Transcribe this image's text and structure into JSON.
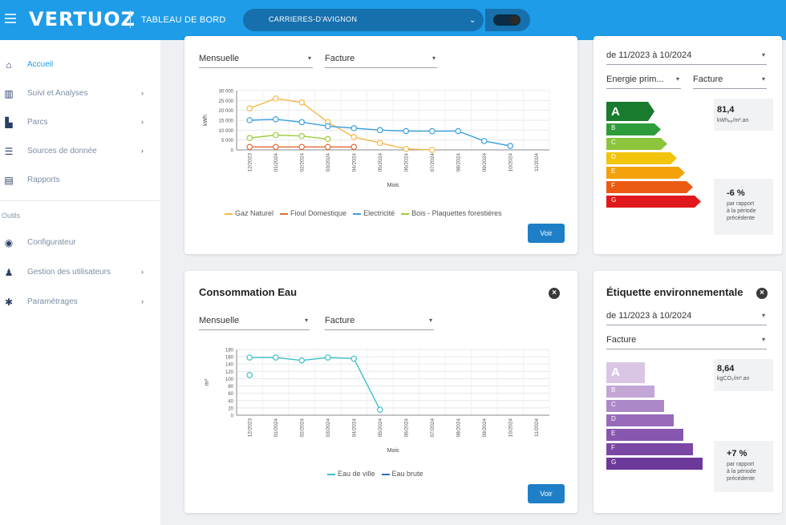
{
  "header": {
    "logo": "VERTUOZ",
    "title": "TABLEAU DE BORD",
    "site": "CARRIERES-D'AVIGNON"
  },
  "sidebar": {
    "items": [
      {
        "label": "Accueil",
        "icon": "home-icon",
        "active": true
      },
      {
        "label": "Suivi et Analyses",
        "icon": "bar-chart-icon",
        "arrow": true
      },
      {
        "label": "Parcs",
        "icon": "buildings-icon",
        "arrow": true
      },
      {
        "label": "Sources de donnée",
        "icon": "database-icon",
        "arrow": true
      },
      {
        "label": "Rapports",
        "icon": "report-icon"
      }
    ],
    "section": "Outils",
    "tools": [
      {
        "label": "Configurateur",
        "icon": "compass-icon"
      },
      {
        "label": "Gestion des utilisateurs",
        "icon": "users-icon",
        "arrow": true
      },
      {
        "label": "Paramétrages",
        "icon": "gear-icon",
        "arrow": true
      }
    ]
  },
  "energy_card": {
    "period_select": "Mensuelle",
    "source_select": "Facture",
    "button": "Voir",
    "legend": [
      {
        "name": "Gaz Naturel",
        "color": "#f6b84a"
      },
      {
        "name": "Fioul Domestique",
        "color": "#e06b3a"
      },
      {
        "name": "Electricité",
        "color": "#3aa0e0"
      },
      {
        "name": "Bois - Plaquettes forestières",
        "color": "#9ccd3c"
      }
    ]
  },
  "water_card": {
    "title": "Consommation Eau",
    "period_select": "Mensuelle",
    "source_select": "Facture",
    "button": "Voir",
    "legend": [
      {
        "name": "Eau de ville",
        "color": "#3cc0c8"
      },
      {
        "name": "Eau brute",
        "color": "#2f6fb0"
      }
    ]
  },
  "dpe_card": {
    "period": "de 11/2023 à 10/2024",
    "type_select": "Energie prim...",
    "source_select": "Facture",
    "grade": "A",
    "value": "81,4",
    "unit": "kWhₑₚ/m².an",
    "delta": "-6 %",
    "delta_text": "par rapport à la période précédente",
    "bars": [
      {
        "letter": "A",
        "color": "#1a7a2e"
      },
      {
        "letter": "B",
        "color": "#2e9c3a"
      },
      {
        "letter": "C",
        "color": "#8cc43c"
      },
      {
        "letter": "D",
        "color": "#f2c40c"
      },
      {
        "letter": "E",
        "color": "#f3a20c"
      },
      {
        "letter": "F",
        "color": "#ec5a12"
      },
      {
        "letter": "G",
        "color": "#e0181c"
      }
    ]
  },
  "env_card": {
    "title": "Étiquette environnementale",
    "period": "de 11/2023 à 10/2024",
    "source_select": "Facture",
    "grade": "A",
    "value": "8,64",
    "unit": "kgCO₂/m².an",
    "delta": "+7 %",
    "delta_text": "par rapport à la période précédente",
    "bars": [
      {
        "letter": "A",
        "color": "#d9c6e4"
      },
      {
        "letter": "B",
        "color": "#c3a5d6"
      },
      {
        "letter": "C",
        "color": "#ad88c8"
      },
      {
        "letter": "D",
        "color": "#976bba"
      },
      {
        "letter": "E",
        "color": "#8756ae"
      },
      {
        "letter": "F",
        "color": "#7a47a4"
      },
      {
        "letter": "G",
        "color": "#6c389a"
      }
    ]
  },
  "chart_data": [
    {
      "type": "line",
      "ylabel": "kWh",
      "xlabel": "Mois",
      "ylim": [
        0,
        30000
      ],
      "yticks": [
        "30 000",
        "25 000",
        "20 000",
        "15 000",
        "10 000",
        "5 000",
        "0"
      ],
      "categories": [
        "12/2023",
        "01/2024",
        "02/2024",
        "03/2024",
        "04/2024",
        "05/2024",
        "06/2024",
        "07/2024",
        "08/2024",
        "09/2024",
        "10/2024",
        "11/2024"
      ],
      "series": [
        {
          "name": "Gaz Naturel",
          "color": "#f6b84a",
          "values": [
            21000,
            26000,
            24000,
            14000,
            6500,
            3500,
            500,
            0,
            null,
            null,
            null,
            null
          ]
        },
        {
          "name": "Fioul Domestique",
          "color": "#e06b3a",
          "values": [
            1500,
            1500,
            1500,
            1500,
            1500,
            null,
            null,
            null,
            null,
            null,
            null,
            null
          ]
        },
        {
          "name": "Electricité",
          "color": "#3aa0e0",
          "values": [
            15000,
            15500,
            14000,
            12000,
            11000,
            10000,
            9500,
            9500,
            9500,
            4500,
            2000,
            null
          ]
        },
        {
          "name": "Bois - Plaquettes forestières",
          "color": "#9ccd3c",
          "values": [
            6000,
            7500,
            7000,
            5500,
            null,
            null,
            null,
            null,
            null,
            null,
            null,
            null
          ]
        }
      ]
    },
    {
      "type": "line",
      "ylabel": "m³",
      "xlabel": "Mois",
      "ylim": [
        0,
        180
      ],
      "yticks": [
        "180",
        "160",
        "140",
        "120",
        "100",
        "80",
        "60",
        "40",
        "20",
        "0"
      ],
      "categories": [
        "12/2023",
        "01/2024",
        "02/2024",
        "03/2024",
        "04/2024",
        "05/2024",
        "06/2024",
        "07/2024",
        "08/2024",
        "09/2024",
        "10/2024",
        "11/2024"
      ],
      "series": [
        {
          "name": "Eau de ville",
          "color": "#3cc0c8",
          "values": [
            158,
            158,
            150,
            158,
            155,
            15,
            null,
            null,
            null,
            null,
            null,
            null
          ]
        },
        {
          "name": "Eau de ville (point)",
          "color": "#3cc0c8",
          "values": [
            110,
            null,
            null,
            null,
            null,
            null,
            null,
            null,
            null,
            null,
            null,
            null
          ]
        }
      ]
    }
  ]
}
